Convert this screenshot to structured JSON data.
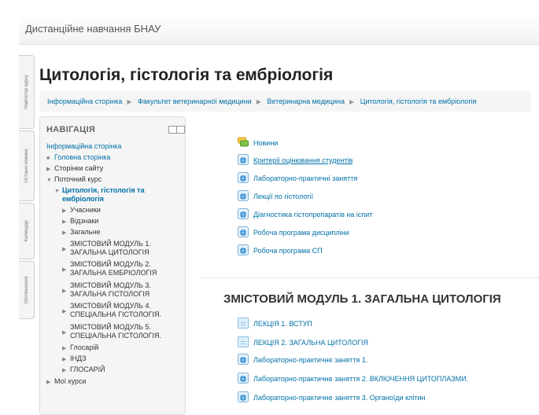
{
  "site": {
    "title": "Дистанційне навчання БНАУ"
  },
  "dock": {
    "tabs": [
      "Навігатор курсу",
      "Останні новини",
      "Календар",
      "Оголошення"
    ]
  },
  "page": {
    "title": "Цитологія, гістологія та ембріологія"
  },
  "breadcrumb": [
    "Інформаційна сторінка",
    "Факультет ветеринарної медицини",
    "Ветеринарна медицина",
    "Цитологія, гістологія та ембріологія"
  ],
  "navigation": {
    "heading": "НАВІГАЦІЯ",
    "items": [
      "Інформаційна сторінка",
      "Головна сторінка",
      "Сторінки сайту",
      "Поточний курс",
      "Цитологія, гістологія та",
      "ембріологія",
      "Учасники",
      "Відзнаки",
      "Загальне",
      "ЗМІСТОВИЙ МОДУЛЬ 1.",
      "ЗАГАЛЬНА ЦИТОЛОГІЯ",
      "ЗМІСТОВИЙ МОДУЛЬ 2.",
      "ЗАГАЛЬНА ЕМБРІОЛОГІЯ",
      "ЗМІСТОВИЙ МОДУЛЬ 3.",
      "ЗАГАЛЬНА ГІСТОЛОГІЯ",
      "ЗМІСТОВИЙ МОДУЛЬ 4.",
      "СПЕЦІАЛЬНА ГІСТОЛОГІЯ.",
      "ЗМІСТОВИЙ МОДУЛЬ 5.",
      "СПЕЦІАЛЬНА ГІСТОЛОГІЯ.",
      "Глосарій",
      "ІНДЗ",
      "ГЛОСАРІЙ",
      "Мої курси"
    ]
  },
  "general_section": {
    "items": [
      "Новини",
      "Критерії оцінювання студентів",
      "Лабораторно-практичні заняття",
      "Лекції по гістології",
      "Діагностика гістопрепаратів на іспит",
      "Робоча програма дисципліни",
      "Робоча програма СП"
    ]
  },
  "module1": {
    "title": "ЗМІСТОВИЙ МОДУЛЬ 1. ЗАГАЛЬНА ЦИТОЛОГІЯ",
    "items": [
      "ЛЕКЦІЯ 1. ВСТУП",
      "ЛЕКЦІЯ 2. ЗАГАЛЬНА ЦИТОЛОГІЯ",
      "Лабораторно-практичне заняття 1.",
      "Лабораторно-практичне заняття 2. ВКЛЮЧЕННЯ ЦИТОПЛАЗМИ.",
      "Лабораторно-практичне заняття 3. Органоїди клітин"
    ]
  },
  "colors": {
    "link": "#0070a8",
    "panel": "#f5f5f5"
  }
}
